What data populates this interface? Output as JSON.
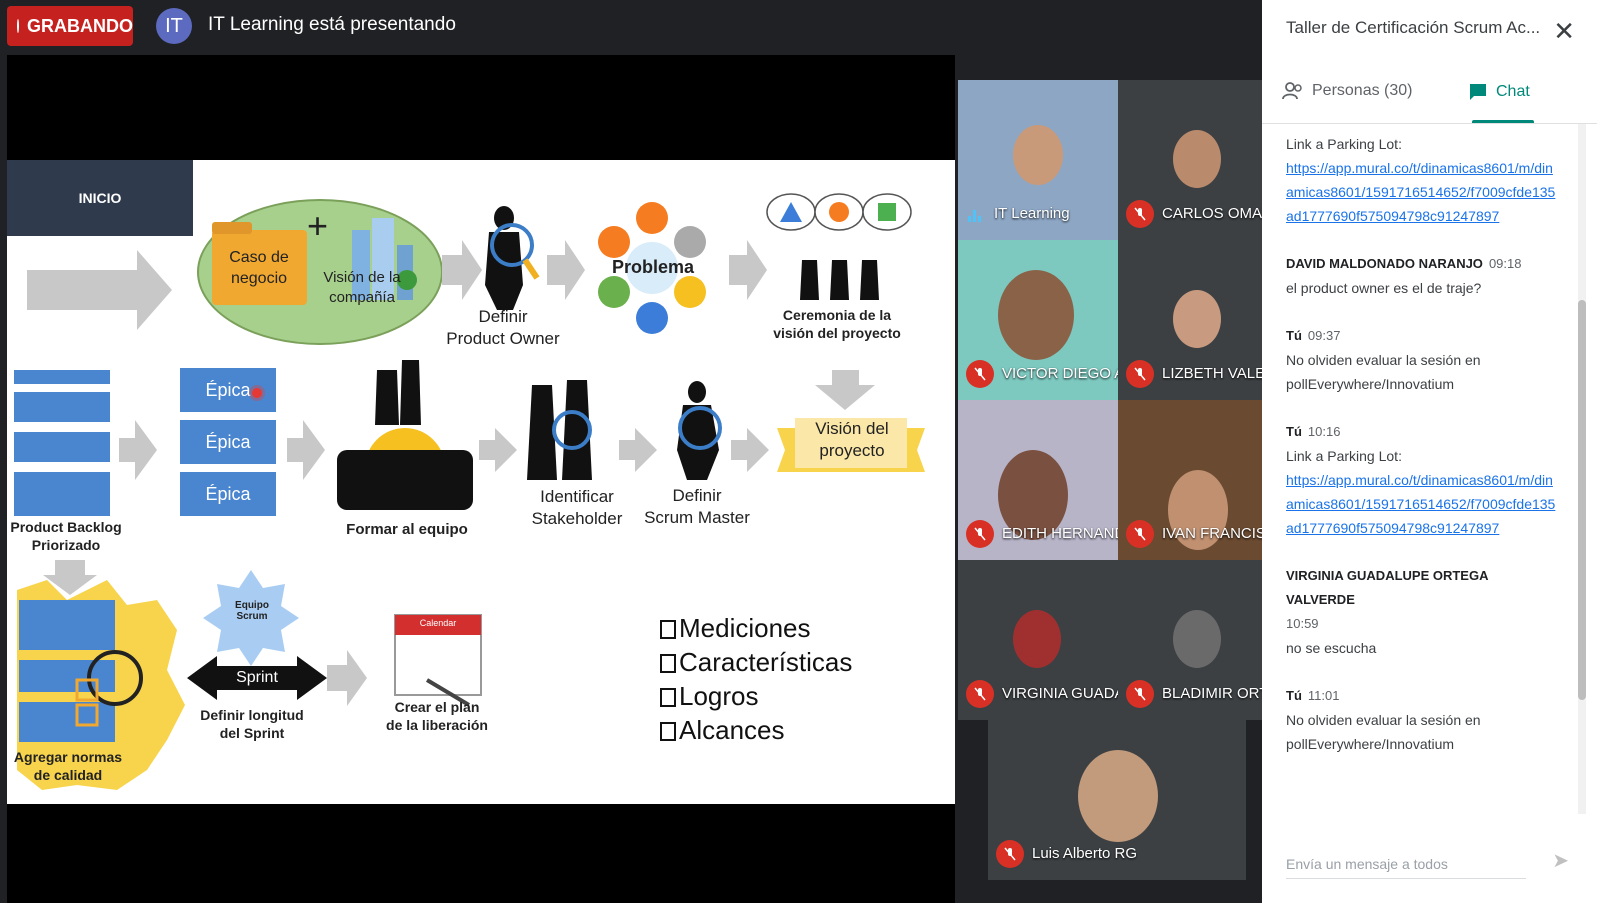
{
  "recording": {
    "label": "GRABANDO"
  },
  "presenter": {
    "initials": "IT",
    "text": "IT Learning está presentando"
  },
  "slide": {
    "inicio": "INICIO",
    "caso_negocio": "Caso de negocio",
    "vision_compania": "Visión de la compañía",
    "definir_po": [
      "Definir",
      "Product Owner"
    ],
    "problema": "Problema",
    "ceremonia": [
      "Ceremonia de la",
      "visión del proyecto"
    ],
    "vision_proyecto": [
      "Visión del",
      "proyecto"
    ],
    "definir_sm": [
      "Definir",
      "Scrum Master"
    ],
    "identificar": [
      "Identificar",
      "Stakeholder"
    ],
    "formar_equipo": "Formar al equipo",
    "epica": [
      "Épica",
      "Épica",
      "Épica"
    ],
    "product_backlog": [
      "Product Backlog",
      "Priorizado"
    ],
    "agregar_normas": [
      "Agregar normas",
      "de calidad"
    ],
    "equipo_scrum": [
      "Equipo",
      "Scrum"
    ],
    "sprint": "Sprint",
    "definir_longitud": [
      "Definir longitud",
      "del Sprint"
    ],
    "calendar": "Calendar",
    "crear_plan": [
      "Crear el plan",
      "de la liberación"
    ],
    "checklist": [
      "Mediciones",
      "Características",
      "Logros",
      "Alcances"
    ]
  },
  "participants": [
    {
      "name": "IT Learning",
      "muted": false
    },
    {
      "name": "CARLOS OMAR ...",
      "muted": true
    },
    {
      "name": "VICTOR DIEGO A...",
      "muted": true
    },
    {
      "name": "LIZBETH VALEN...",
      "muted": true
    },
    {
      "name": "EDITH HERNAND...",
      "muted": true
    },
    {
      "name": "IVAN FRANCISC...",
      "muted": true
    },
    {
      "name": "VIRGINIA GUADA...",
      "muted": true
    },
    {
      "name": "BLADIMIR ORTE...",
      "muted": true
    },
    {
      "name": "Luis Alberto RG",
      "muted": true
    }
  ],
  "panel": {
    "title": "Taller de Certificación Scrum Ac...",
    "close_icon": "close-icon",
    "tab_people": "Personas (30)",
    "tab_chat": "Chat",
    "messages": [
      {
        "sender": "",
        "time": "",
        "text": "Link a Parking Lot:",
        "link": "https://app.mural.co/t/dinamicas8601/m/dinamicas8601/1591716514652/f7009cfde135ad1777690f575094798c91247897"
      },
      {
        "sender": "DAVID MALDONADO NARANJO",
        "time": "09:18",
        "text": "el product owner es el de traje?",
        "link": ""
      },
      {
        "sender": "Tú",
        "time": "09:37",
        "text": "No olviden evaluar la sesión en pollEverywhere/Innovatium",
        "link": ""
      },
      {
        "sender": "Tú",
        "time": "10:16",
        "text": "Link a Parking Lot:",
        "link": "https://app.mural.co/t/dinamicas8601/m/dinamicas8601/1591716514652/f7009cfde135ad1777690f575094798c91247897"
      },
      {
        "sender": "VIRGINIA GUADALUPE ORTEGA VALVERDE",
        "time": "10:59",
        "text": "no se escucha",
        "link": ""
      },
      {
        "sender": "Tú",
        "time": "11:01",
        "text": "No olviden evaluar la sesión en pollEverywhere/Innovatium",
        "link": ""
      }
    ],
    "input_placeholder": "Envía un mensaje a todos"
  }
}
